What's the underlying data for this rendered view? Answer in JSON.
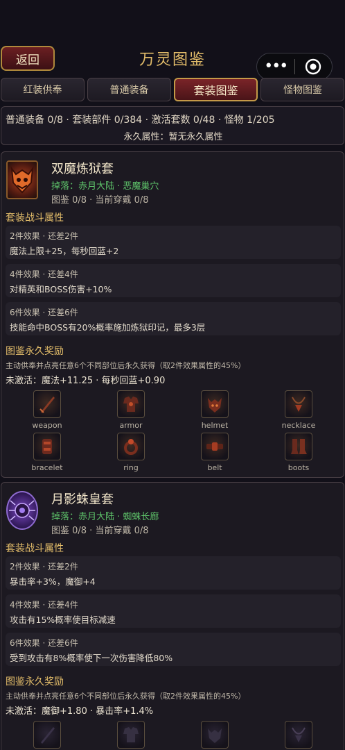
{
  "header": {
    "back_label": "返回",
    "title": "万灵图鉴",
    "capsule_dots": "•••"
  },
  "tabs": [
    {
      "label": "红装供奉",
      "active": false
    },
    {
      "label": "普通装备",
      "active": false
    },
    {
      "label": "套装图鉴",
      "active": true
    },
    {
      "label": "怪物图鉴",
      "active": false
    }
  ],
  "summary": {
    "line1": "普通装备 0/8 · 套装部件 0/384 · 激活套数 0/48 · 怪物 1/205",
    "line2": "永久属性：暂无永久属性"
  },
  "sets": [
    {
      "name": "双魔炼狱套",
      "icon": "demon-helmet-icon",
      "drop": "掉落：赤月大陆 · 恶魔巢穴",
      "collect": "图鉴 0/8 · 当前穿戴 0/8",
      "battle_title": "套装战斗属性",
      "effects": [
        {
          "head": "2件效果 · 还差2件",
          "desc": "魔法上限+25，每秒回蓝+2"
        },
        {
          "head": "4件效果 · 还差4件",
          "desc": "对精英和BOSS伤害+10%"
        },
        {
          "head": "6件效果 · 还差6件",
          "desc": "技能命中BOSS有20%概率施加炼狱印记，最多3层"
        }
      ],
      "reward_title": "图鉴永久奖励",
      "reward_note": "主动供奉并点亮任意6个不同部位后永久获得（取2件效果属性的45%）",
      "reward_status": "未激活：魔法+11.25 · 每秒回蓝+0.90",
      "slots": [
        "weapon",
        "armor",
        "helmet",
        "necklace",
        "bracelet",
        "ring",
        "belt",
        "boots"
      ]
    },
    {
      "name": "月影蛛皇套",
      "icon": "spider-orb-icon",
      "drop": "掉落：赤月大陆 · 蜘蛛长廊",
      "collect": "图鉴 0/8 · 当前穿戴 0/8",
      "battle_title": "套装战斗属性",
      "effects": [
        {
          "head": "2件效果 · 还差2件",
          "desc": "暴击率+3%，魔御+4"
        },
        {
          "head": "4件效果 · 还差4件",
          "desc": "攻击有15%概率使目标减速"
        },
        {
          "head": "6件效果 · 还差6件",
          "desc": "受到攻击有8%概率使下一次伤害降低80%"
        }
      ],
      "reward_title": "图鉴永久奖励",
      "reward_note": "主动供奉并点亮任意6个不同部位后永久获得（取2件效果属性的45%）",
      "reward_status": "未激活：魔御+1.80 · 暴击率+1.4%"
    }
  ]
}
